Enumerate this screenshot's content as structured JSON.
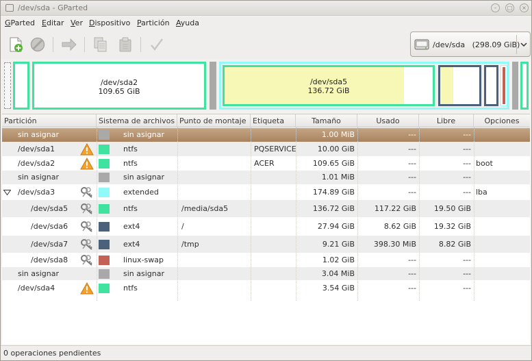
{
  "window": {
    "title": "/dev/sda - GParted"
  },
  "menu": {
    "items": [
      {
        "label": "GParted",
        "mnemonic": "G",
        "rest": "Parted"
      },
      {
        "label": "Editar",
        "mnemonic": "E",
        "rest": "ditar"
      },
      {
        "label": "Ver",
        "mnemonic": "V",
        "rest": "er"
      },
      {
        "label": "Dispositivo",
        "mnemonic": "D",
        "rest": "ispositivo"
      },
      {
        "label": "Partición",
        "mnemonic": "P",
        "rest": "artición"
      },
      {
        "label": "Ayuda",
        "mnemonic": "A",
        "rest": "yuda"
      }
    ]
  },
  "toolbar": {
    "icons": [
      "new-partition-icon",
      "delete-icon",
      "resize-move-icon",
      "copy-icon",
      "paste-icon",
      "apply-icon"
    ],
    "device": {
      "path": "/dev/sda",
      "size": "(298.09 GiB)"
    }
  },
  "map": {
    "sda2": {
      "name": "/dev/sda2",
      "size": "109.65 GiB"
    },
    "sda5": {
      "name": "/dev/sda5",
      "size": "136.72 GiB"
    }
  },
  "colors": {
    "ntfs": "#3fe39f",
    "unallocated": "#a9a9a9",
    "extended": "#8ffaf8",
    "ext4": "#4a607b",
    "swap": "#c46155",
    "used": "#f8f8b6",
    "selected": "#b89371"
  },
  "table": {
    "headers": [
      "Partición",
      "Sistema de archivos",
      "Punto de montaje",
      "Etiqueta",
      "Tamaño",
      "Usado",
      "Libre",
      "Opciones"
    ],
    "rows": [
      {
        "partition": "sin asignar",
        "fs": "sin asignar",
        "mount": "",
        "label": "",
        "size": "1.00 MiB",
        "used": "---",
        "free": "---",
        "flags": "",
        "color": "#a9a9a9",
        "icon": "",
        "indent": 1,
        "selected": true
      },
      {
        "partition": "/dev/sda1",
        "fs": "ntfs",
        "mount": "",
        "label": "PQSERVICE",
        "size": "10.00 GiB",
        "used": "---",
        "free": "---",
        "flags": "",
        "color": "#3fe39f",
        "icon": "warning-icon",
        "indent": 1
      },
      {
        "partition": "/dev/sda2",
        "fs": "ntfs",
        "mount": "",
        "label": "ACER",
        "size": "109.65 GiB",
        "used": "---",
        "free": "---",
        "flags": "boot",
        "color": "#3fe39f",
        "icon": "warning-icon",
        "indent": 1
      },
      {
        "partition": "sin asignar",
        "fs": "sin asignar",
        "mount": "",
        "label": "",
        "size": "1.01 MiB",
        "used": "---",
        "free": "---",
        "flags": "",
        "color": "#a9a9a9",
        "icon": "",
        "indent": 1
      },
      {
        "partition": "/dev/sda3",
        "fs": "extended",
        "mount": "",
        "label": "",
        "size": "174.89 GiB",
        "used": "---",
        "free": "---",
        "flags": "lba",
        "color": "#8ffaf8",
        "icon": "key-icon",
        "indent": 1,
        "expander": true
      },
      {
        "partition": "/dev/sda5",
        "fs": "ntfs",
        "mount": "/media/sda5",
        "label": "",
        "size": "136.72 GiB",
        "used": "117.22 GiB",
        "free": "19.50 GiB",
        "flags": "",
        "color": "#3fe39f",
        "icon": "key-icon",
        "indent": 2
      },
      {
        "partition": "/dev/sda6",
        "fs": "ext4",
        "mount": "/",
        "label": "",
        "size": "27.94 GiB",
        "used": "8.62 GiB",
        "free": "19.32 GiB",
        "flags": "",
        "color": "#4a607b",
        "icon": "key-icon",
        "indent": 2
      },
      {
        "partition": "/dev/sda7",
        "fs": "ext4",
        "mount": "/tmp",
        "label": "",
        "size": "9.21 GiB",
        "used": "398.30 MiB",
        "free": "8.82 GiB",
        "flags": "",
        "color": "#4a607b",
        "icon": "key-icon",
        "indent": 2
      },
      {
        "partition": "/dev/sda8",
        "fs": "linux-swap",
        "mount": "",
        "label": "",
        "size": "1.02 GiB",
        "used": "---",
        "free": "---",
        "flags": "",
        "color": "#c46155",
        "icon": "key-icon",
        "indent": 2
      },
      {
        "partition": "sin asignar",
        "fs": "sin asignar",
        "mount": "",
        "label": "",
        "size": "3.04 MiB",
        "used": "---",
        "free": "---",
        "flags": "",
        "color": "#a9a9a9",
        "icon": "",
        "indent": 1
      },
      {
        "partition": "/dev/sda4",
        "fs": "ntfs",
        "mount": "",
        "label": "",
        "size": "3.54 GiB",
        "used": "---",
        "free": "---",
        "flags": "",
        "color": "#3fe39f",
        "icon": "warning-icon",
        "indent": 1
      }
    ]
  },
  "status": {
    "text": "0 operaciones pendientes"
  }
}
